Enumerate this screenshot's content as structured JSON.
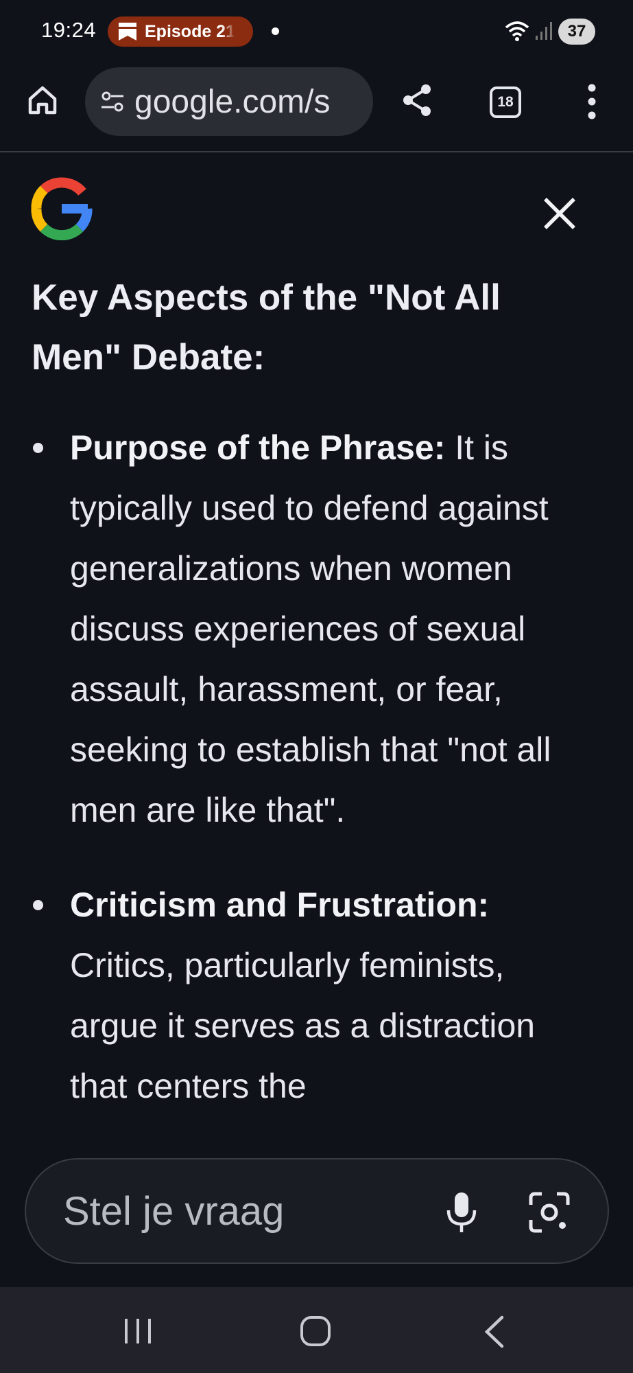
{
  "status_bar": {
    "time": "19:24",
    "episode_label": "Episode 21",
    "battery": "37",
    "icons": [
      "episode-icon",
      "wifi-icon",
      "signal-icon",
      "battery-icon"
    ],
    "colors": {
      "episode_pill": "#8b2b10"
    }
  },
  "toolbar": {
    "url": "google.com/s",
    "tab_count": "18",
    "icons": [
      "home-icon",
      "site-settings-icon",
      "share-icon",
      "tabs-icon",
      "more-vert-icon"
    ]
  },
  "panel": {
    "logo": "google-g-logo",
    "close_icon": "close-icon"
  },
  "content": {
    "heading": "Key Aspects of the \"Not All Men\" Debate:",
    "bullets": [
      {
        "title": "Purpose of the Phrase:",
        "text": "It is typically used to defend against generalizations when women discuss experiences of sexual assault, harassment, or fear, seeking to establish that \"not all men are like that\"."
      },
      {
        "title": "Criticism and Frustration:",
        "text": "Critics, particularly feminists, argue it serves as a distraction that centers the"
      }
    ]
  },
  "ask_bar": {
    "placeholder": "Stel je vraag",
    "icons": [
      "mic-icon",
      "lens-icon"
    ]
  },
  "nav_bar": {
    "icons": [
      "recents-icon",
      "home-nav-icon",
      "back-icon"
    ]
  },
  "theme": {
    "background": "#10121a",
    "text": "#e7e8ee",
    "surface": "#2a2d33",
    "nav": "#22232a"
  }
}
